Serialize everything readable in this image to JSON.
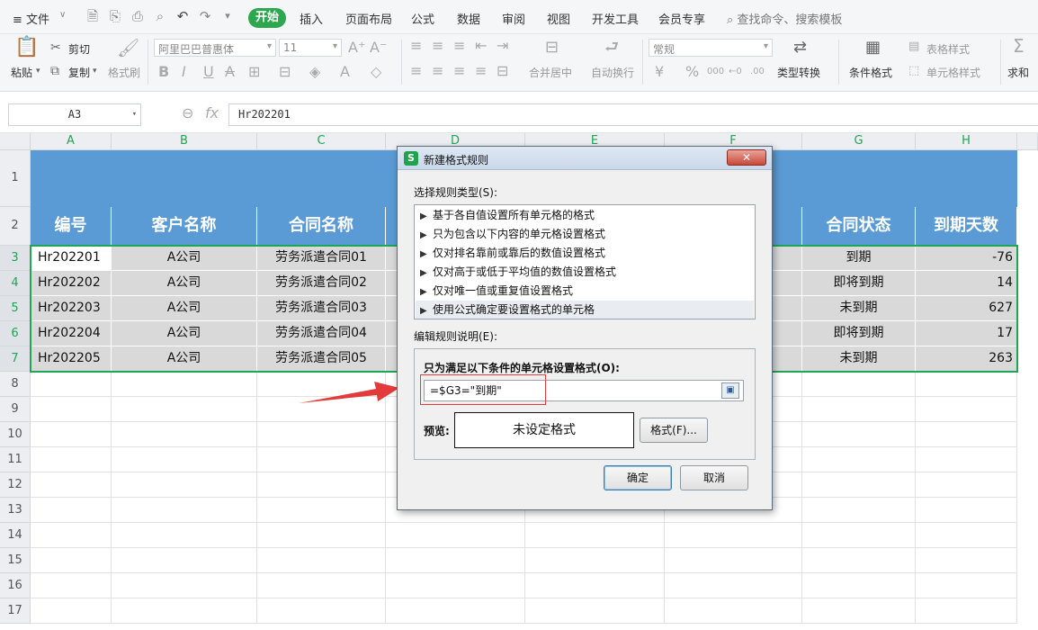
{
  "menubar": {
    "file_menu": "≡ 文件",
    "tabs": [
      "开始",
      "插入",
      "页面布局",
      "公式",
      "数据",
      "审阅",
      "视图",
      "开发工具",
      "会员专享"
    ],
    "active_tab": "开始",
    "search_placeholder": "查找命令、搜索模板"
  },
  "ribbon": {
    "paste": "粘贴",
    "cut": "剪切",
    "copy": "复制",
    "format_painter": "格式刷",
    "font_name": "阿里巴巴普惠体",
    "font_size": "11",
    "merge_center": "合并居中",
    "auto_wrap": "自动换行",
    "number_format": "常规",
    "type_convert": "类型转换",
    "conditional_format": "条件格式",
    "table_style": "表格样式",
    "cell_style": "单元格样式",
    "sum": "求和"
  },
  "formula_bar": {
    "name_box": "A3",
    "fx": "fx",
    "value": "Hr202201"
  },
  "sheet": {
    "columns": [
      "A",
      "B",
      "C",
      "D",
      "E",
      "F",
      "G",
      "H"
    ],
    "rows": [
      "1",
      "2",
      "3",
      "4",
      "5",
      "6",
      "7",
      "8",
      "9",
      "10",
      "11",
      "12",
      "13",
      "14",
      "15",
      "16",
      "17"
    ],
    "headers": {
      "A": "编号",
      "B": "客户名称",
      "C": "合同名称",
      "G": "合同状态",
      "H": "到期天数"
    },
    "data": [
      {
        "id": "Hr202201",
        "customer": "A公司",
        "contract": "劳务派遣合同01",
        "status": "到期",
        "days": "-76"
      },
      {
        "id": "Hr202202",
        "customer": "A公司",
        "contract": "劳务派遣合同02",
        "status": "即将到期",
        "days": "14"
      },
      {
        "id": "Hr202203",
        "customer": "A公司",
        "contract": "劳务派遣合同03",
        "status": "未到期",
        "days": "627"
      },
      {
        "id": "Hr202204",
        "customer": "A公司",
        "contract": "劳务派遣合同04",
        "status": "即将到期",
        "days": "17"
      },
      {
        "id": "Hr202205",
        "customer": "A公司",
        "contract": "劳务派遣合同05",
        "status": "未到期",
        "days": "263"
      }
    ]
  },
  "dialog": {
    "title": "新建格式规则",
    "close": "✕",
    "select_type_label": "选择规则类型(S):",
    "rule_types": [
      "基于各自值设置所有单元格的格式",
      "只为包含以下内容的单元格设置格式",
      "仅对排名靠前或靠后的数值设置格式",
      "仅对高于或低于平均值的数值设置格式",
      "仅对唯一值或重复值设置格式",
      "使用公式确定要设置格式的单元格"
    ],
    "edit_desc_label": "编辑规则说明(E):",
    "condition_label": "只为满足以下条件的单元格设置格式(O):",
    "formula": "=$G3=\"到期\"",
    "preview_label": "预览:",
    "preview_text": "未设定格式",
    "format_button": "格式(F)...",
    "ok_button": "确定",
    "cancel_button": "取消"
  },
  "colors": {
    "accent": "#2da650",
    "header_fill": "#5b9bd5",
    "data_fill": "#d9d9d9",
    "highlight": "#e23c3c"
  }
}
